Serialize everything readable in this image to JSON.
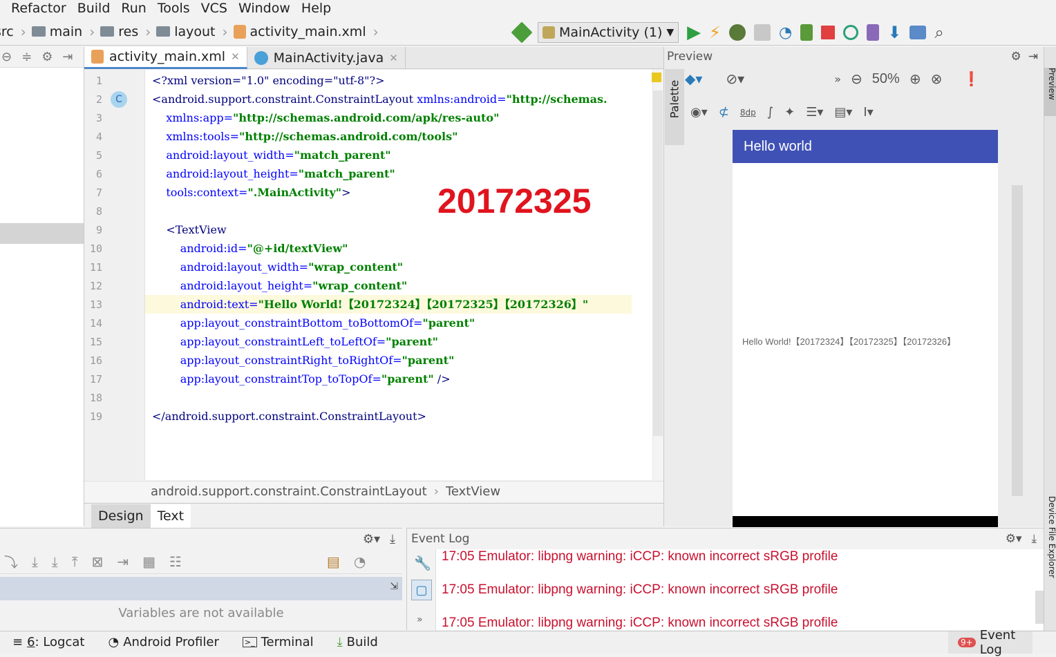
{
  "menu": [
    "Refactor",
    "Build",
    "Run",
    "Tools",
    "VCS",
    "Window",
    "Help"
  ],
  "breadcrumb": [
    "src",
    "main",
    "res",
    "layout",
    "activity_main.xml"
  ],
  "run_config": "MainActivity (1)",
  "editor_tabs": [
    "activity_main.xml",
    "MainActivity.java"
  ],
  "code_lines": [
    {
      "n": "1",
      "parts": [
        [
          "tg",
          "<?xml version=\"1.0\" encoding=\"utf-8\"?>"
        ]
      ]
    },
    {
      "n": "2",
      "parts": [
        [
          "tg",
          "<android.support.constraint.ConstraintLayout "
        ],
        [
          "an",
          "xmlns:android="
        ],
        [
          "av",
          "\"http://schemas."
        ]
      ]
    },
    {
      "n": "3",
      "parts": [
        [
          "an",
          "    xmlns:app="
        ],
        [
          "av",
          "\"http://schemas.android.com/apk/res-auto\""
        ]
      ]
    },
    {
      "n": "4",
      "parts": [
        [
          "an",
          "    xmlns:tools="
        ],
        [
          "av",
          "\"http://schemas.android.com/tools\""
        ]
      ]
    },
    {
      "n": "5",
      "parts": [
        [
          "an",
          "    android:layout_width="
        ],
        [
          "av",
          "\"match_parent\""
        ]
      ]
    },
    {
      "n": "6",
      "parts": [
        [
          "an",
          "    android:layout_height="
        ],
        [
          "av",
          "\"match_parent\""
        ]
      ]
    },
    {
      "n": "7",
      "parts": [
        [
          "an",
          "    tools:context="
        ],
        [
          "av",
          "\".MainActivity\""
        ],
        [
          "tg",
          ">"
        ]
      ]
    },
    {
      "n": "8",
      "parts": []
    },
    {
      "n": "9",
      "parts": [
        [
          "tg",
          "    <TextView"
        ]
      ]
    },
    {
      "n": "10",
      "parts": [
        [
          "an",
          "        android:id="
        ],
        [
          "av",
          "\"@+id/textView\""
        ]
      ]
    },
    {
      "n": "11",
      "parts": [
        [
          "an",
          "        android:layout_width="
        ],
        [
          "av",
          "\"wrap_content\""
        ]
      ]
    },
    {
      "n": "12",
      "parts": [
        [
          "an",
          "        android:layout_height="
        ],
        [
          "av",
          "\"wrap_content\""
        ]
      ]
    },
    {
      "n": "13",
      "parts": [
        [
          "an",
          "        android:text="
        ],
        [
          "av",
          "\"Hello World!【20172324】【20172325】【20172326】\""
        ]
      ]
    },
    {
      "n": "14",
      "parts": [
        [
          "an",
          "        app:layout_constraintBottom_toBottomOf="
        ],
        [
          "av",
          "\"parent\""
        ]
      ]
    },
    {
      "n": "15",
      "parts": [
        [
          "an",
          "        app:layout_constraintLeft_toLeftOf="
        ],
        [
          "av",
          "\"parent\""
        ]
      ]
    },
    {
      "n": "16",
      "parts": [
        [
          "an",
          "        app:layout_constraintRight_toRightOf="
        ],
        [
          "av",
          "\"parent\""
        ]
      ]
    },
    {
      "n": "17",
      "parts": [
        [
          "an",
          "        app:layout_constraintTop_toTopOf="
        ],
        [
          "av",
          "\"parent\""
        ],
        [
          "tg",
          " />"
        ]
      ]
    },
    {
      "n": "18",
      "parts": []
    },
    {
      "n": "19",
      "parts": [
        [
          "tg",
          "</android.support.constraint.ConstraintLayout>"
        ]
      ]
    }
  ],
  "highlight_line": "13",
  "stamp": "20172325",
  "code_breadcrumb": [
    "android.support.constraint.ConstraintLayout",
    "TextView"
  ],
  "design_tabs": {
    "design": "Design",
    "text": "Text"
  },
  "preview": {
    "title": "Preview",
    "palette": "Palette",
    "zoom": "50%",
    "dp": "8dp",
    "app_title": "Hello world",
    "content_text": "Hello World!【20172324】【20172325】【20172326】"
  },
  "right_strip": {
    "preview": "Preview",
    "device": "Device File Explorer"
  },
  "debug": {
    "variables": "Variables are not available"
  },
  "event_log": {
    "title": "Event Log",
    "lines": [
      "17:05  Emulator: libpng warning: iCCP: known incorrect sRGB profile",
      "17:05  Emulator: libpng warning: iCCP: known incorrect sRGB profile",
      "17:05  Emulator: libpng warning: iCCP: known incorrect sRGB profile"
    ]
  },
  "statusbar": {
    "logcat_num": "6",
    "logcat": ": Logcat",
    "profiler": "Android Profiler",
    "terminal": "Terminal",
    "build": "Build",
    "event_badge": "9+",
    "event_log": "Event Log"
  },
  "colors": {
    "accent": "#3f51b5",
    "error": "#c8102e",
    "stamp": "#e0141e",
    "run": "#2ea043",
    "stop": "#e04040"
  }
}
